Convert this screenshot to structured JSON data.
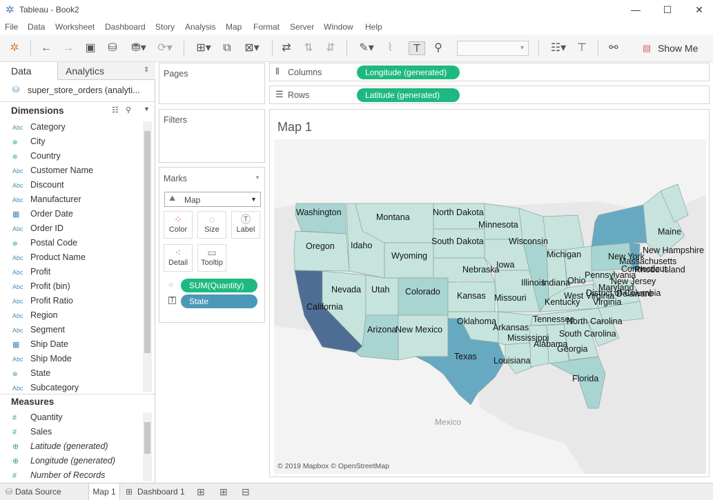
{
  "window": {
    "title": "Tableau - Book2",
    "minimize": "—",
    "maximize": "☐",
    "close": "✕"
  },
  "menu": [
    "File",
    "Data",
    "Worksheet",
    "Dashboard",
    "Story",
    "Analysis",
    "Map",
    "Format",
    "Server",
    "Window",
    "Help"
  ],
  "toolbar": {
    "show_me": "Show Me"
  },
  "left": {
    "tab_data": "Data",
    "tab_analytics": "Analytics",
    "datasource": "super_store_orders (analyti...",
    "dimensions_label": "Dimensions",
    "dimensions": [
      {
        "name": "Category",
        "type": "Abc"
      },
      {
        "name": "City",
        "type": "geo"
      },
      {
        "name": "Country",
        "type": "geo"
      },
      {
        "name": "Customer Name",
        "type": "Abc"
      },
      {
        "name": "Discount",
        "type": "Abc"
      },
      {
        "name": "Manufacturer",
        "type": "Abc"
      },
      {
        "name": "Order Date",
        "type": "date"
      },
      {
        "name": "Order ID",
        "type": "Abc"
      },
      {
        "name": "Postal Code",
        "type": "geo"
      },
      {
        "name": "Product Name",
        "type": "Abc"
      },
      {
        "name": "Profit",
        "type": "Abc"
      },
      {
        "name": "Profit (bin)",
        "type": "Abc"
      },
      {
        "name": "Profit Ratio",
        "type": "Abc"
      },
      {
        "name": "Region",
        "type": "Abc"
      },
      {
        "name": "Segment",
        "type": "Abc"
      },
      {
        "name": "Ship Date",
        "type": "date"
      },
      {
        "name": "Ship Mode",
        "type": "Abc"
      },
      {
        "name": "State",
        "type": "geo"
      },
      {
        "name": "Subcategory",
        "type": "Abc"
      }
    ],
    "measures_label": "Measures",
    "measures": [
      {
        "name": "Quantity",
        "type": "#"
      },
      {
        "name": "Sales",
        "type": "#"
      },
      {
        "name": "Latitude (generated)",
        "type": "geo"
      },
      {
        "name": "Longitude (generated)",
        "type": "geo"
      },
      {
        "name": "Number of Records",
        "type": "#"
      }
    ]
  },
  "cards": {
    "pages": "Pages",
    "filters": "Filters",
    "marks": "Marks",
    "mark_type": "Map",
    "buttons": [
      "Color",
      "Size",
      "Label",
      "Detail",
      "Tooltip"
    ],
    "pill_quantity": "SUM(Quantity)",
    "pill_state": "State"
  },
  "shelves": {
    "columns_label": "Columns",
    "columns_pill": "Longitude (generated)",
    "rows_label": "Rows",
    "rows_pill": "Latitude (generated)"
  },
  "viz": {
    "title": "Map 1",
    "attribution": "© 2019 Mapbox © OpenStreetMap",
    "mexico": "Mexico",
    "united": "United",
    "states": [
      "Washington",
      "Montana",
      "North Dakota",
      "Minnesota",
      "Maine",
      "Oregon",
      "Idaho",
      "South Dakota",
      "Wisconsin",
      "New Hampshire",
      "New York",
      "Massachusetts",
      "Connecticut",
      "Rhode Island",
      "Wyoming",
      "Michigan",
      "Nebraska",
      "Iowa",
      "Pennsylvania",
      "Illinois",
      "Indiana",
      "Ohio",
      "New Jersey",
      "Nevada",
      "Utah",
      "Colorado",
      "Maryland",
      "District of Columbia",
      "Delaware",
      "West Virginia",
      "Virginia",
      "Kansas",
      "Missouri",
      "Kentucky",
      "California",
      "Tennessee",
      "North Carolina",
      "Oklahoma",
      "Arkansas",
      "Arizona",
      "New Mexico",
      "South Carolina",
      "Mississippi",
      "Alabama",
      "Georgia",
      "Texas",
      "Louisiana",
      "Florida"
    ]
  },
  "status": {
    "data_source": "Data Source",
    "sheet": "Map 1",
    "dashboard": "Dashboard 1"
  },
  "colors": {
    "green_pill": "#1eb980",
    "blue_pill": "#4b98b8",
    "map_dark": "#4f6d94",
    "map_light": "#c6e4dd"
  }
}
